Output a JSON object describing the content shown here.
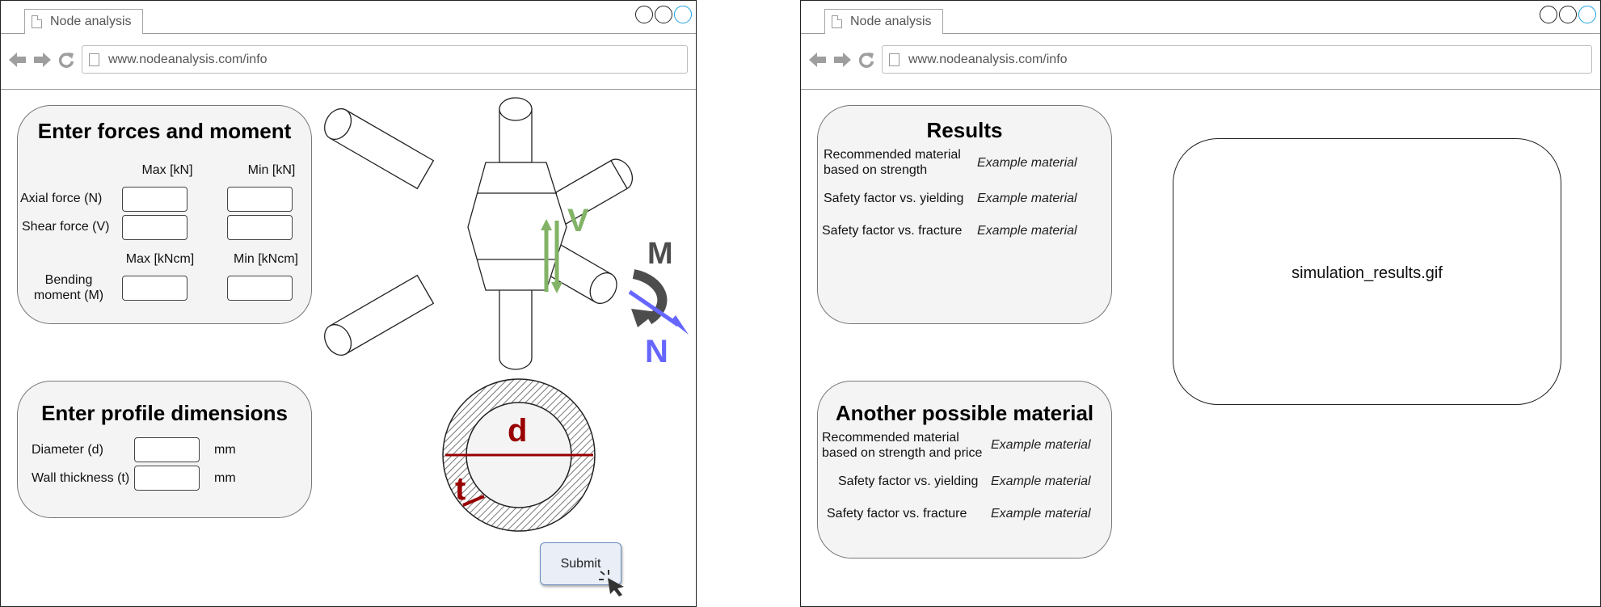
{
  "browser": {
    "tab_title": "Node analysis",
    "url": "www.nodeanalysis.com/info"
  },
  "forces_panel": {
    "title": "Enter forces and moment",
    "col_max_kn": "Max [kN]",
    "col_min_kn": "Min [kN]",
    "axial_label": "Axial force (N)",
    "shear_label": "Shear force (V)",
    "col_max_kncm": "Max [kNcm]",
    "col_min_kncm": "Min [kNcm]",
    "bending_label_line1": "Bending",
    "bending_label_line2": "moment (M)"
  },
  "profile_panel": {
    "title": "Enter profile dimensions",
    "diameter_label": "Diameter (d)",
    "wall_label": "Wall thickness (t)",
    "unit": "mm"
  },
  "diagram": {
    "shear_symbol": "V",
    "moment_symbol": "M",
    "axial_symbol": "N",
    "diameter_symbol": "d",
    "thickness_symbol": "t",
    "colors": {
      "shear": "#82b366",
      "moment": "#4d4d4d",
      "axial": "#6666ff",
      "section": "#990000"
    }
  },
  "submit_label": "Submit",
  "results_panel": {
    "title": "Results",
    "rows": [
      {
        "label_line1": "Recommended material",
        "label_line2": "based on strength",
        "value": "Example material"
      },
      {
        "label_line1": "Safety factor vs. yielding",
        "value": "Example material"
      },
      {
        "label_line1": "Safety factor vs. fracture",
        "value": "Example material"
      }
    ]
  },
  "alt_panel": {
    "title": "Another possible material",
    "rows": [
      {
        "label_line1": "Recommended material",
        "label_line2": "based on strength and price",
        "value": "Example material"
      },
      {
        "label_line1": "Safety factor vs. yielding",
        "value": "Example material"
      },
      {
        "label_line1": "Safety factor vs. fracture",
        "value": "Example material"
      }
    ]
  },
  "gif_label": "simulation_results.gif"
}
